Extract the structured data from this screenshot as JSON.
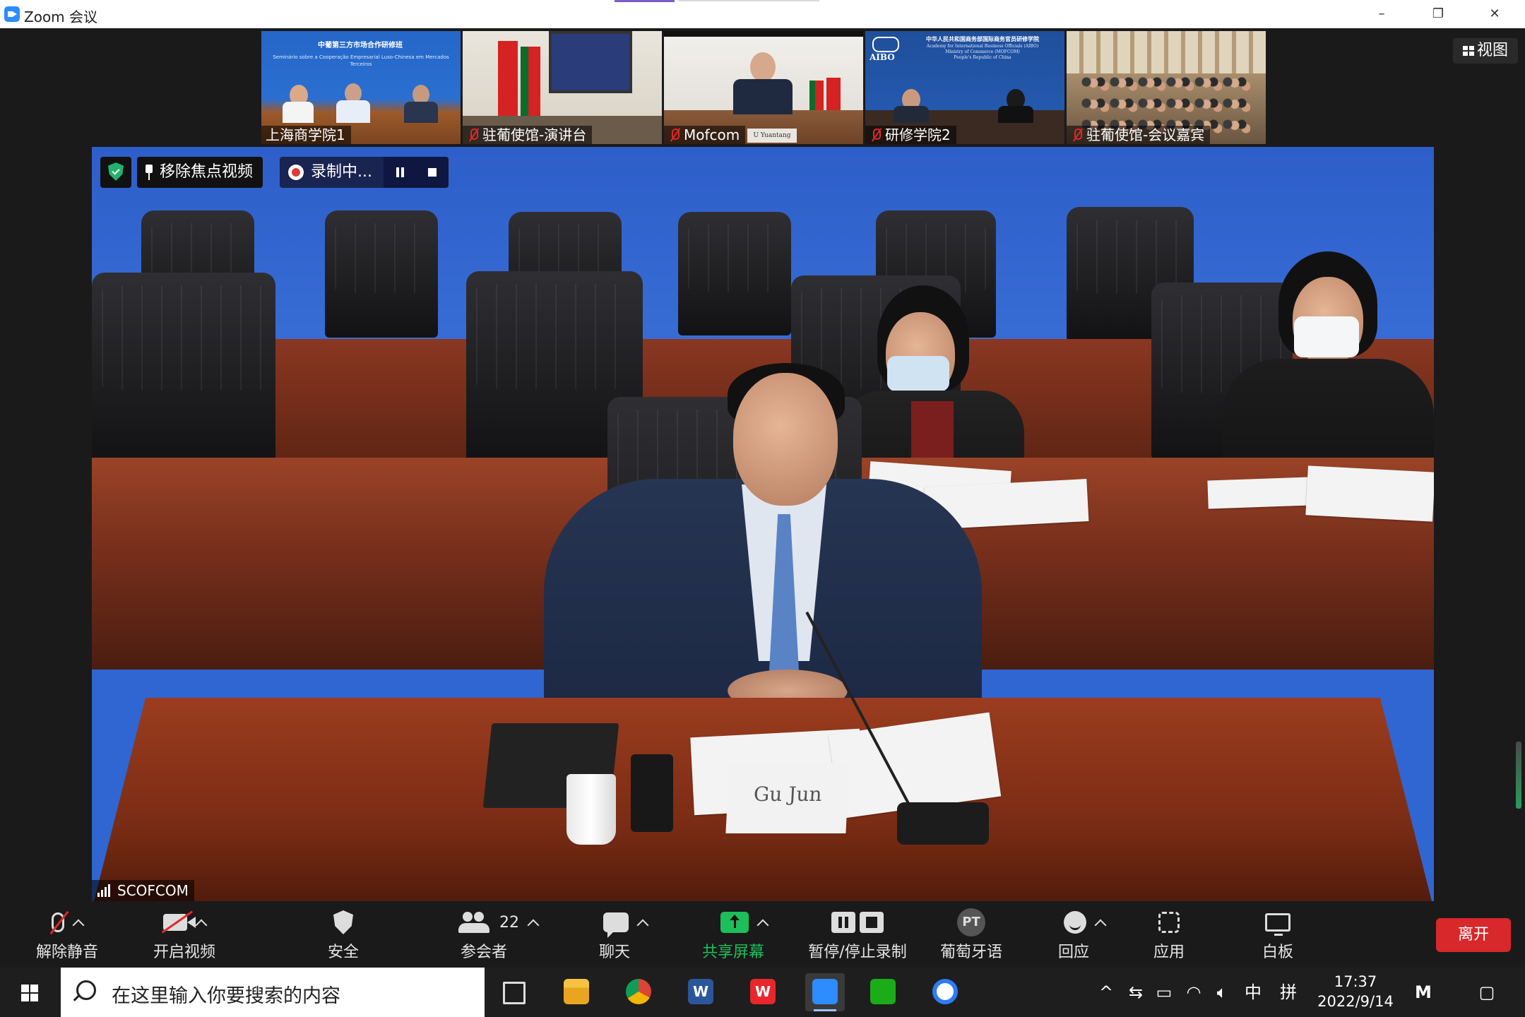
{
  "window": {
    "title": "Zoom 会议",
    "minimize": "–",
    "maximize": "❐",
    "close": "✕"
  },
  "view_button": {
    "label": "视图"
  },
  "participants": [
    {
      "name": "上海商学院1",
      "muted": false
    },
    {
      "name": "驻葡使馆-演讲台",
      "muted": true
    },
    {
      "name": "Mofcom",
      "muted": true
    },
    {
      "name": "研修学院2",
      "muted": true
    },
    {
      "name": "驻葡使馆-会议嘉宾",
      "muted": true
    }
  ],
  "thumb_texts": {
    "thumb1_banner_title": "中葡第三方市场合作研修班",
    "thumb1_banner_subtitle": "Seminário sobre a Cooperação Empresarial Luso-Chinesa em Mercados Terceiros",
    "thumb3_nameplate": "U Yuantang",
    "thumb4_logo": "AIBO",
    "thumb4_banner_title": "中华人民共和国商务部国际商务官员研修学院",
    "thumb4_banner_en1": "Academy for International Business Officials (AIBO)",
    "thumb4_banner_en2": "Ministry of Commerce (MOFCOM)",
    "thumb4_banner_en3": "People's Republic of China"
  },
  "main_video": {
    "unpin_label": "移除焦点视频",
    "recording_label": "录制中...",
    "speaker_name": "SCOFCOM",
    "nameplate": "Gu Jun"
  },
  "toolbar": {
    "unmute": "解除静音",
    "start_video": "开启视频",
    "security": "安全",
    "participants": "参会者",
    "participants_count": "22",
    "chat": "聊天",
    "share_screen": "共享屏幕",
    "pause_stop_recording": "暂停/停止录制",
    "interpretation": "葡萄牙语",
    "interpretation_badge": "PT",
    "reactions": "回应",
    "apps": "应用",
    "whiteboard": "白板",
    "leave": "离开"
  },
  "taskbar": {
    "search_placeholder": "在这里输入你要搜索的内容",
    "ime_lang": "中",
    "ime_mode": "拼",
    "time": "17:37",
    "date": "2022/9/14"
  },
  "colors": {
    "leave_red": "#d8282b",
    "share_green": "#1dbf5a",
    "zoom_blue": "#2d8cff",
    "security_green": "#23b26d"
  }
}
